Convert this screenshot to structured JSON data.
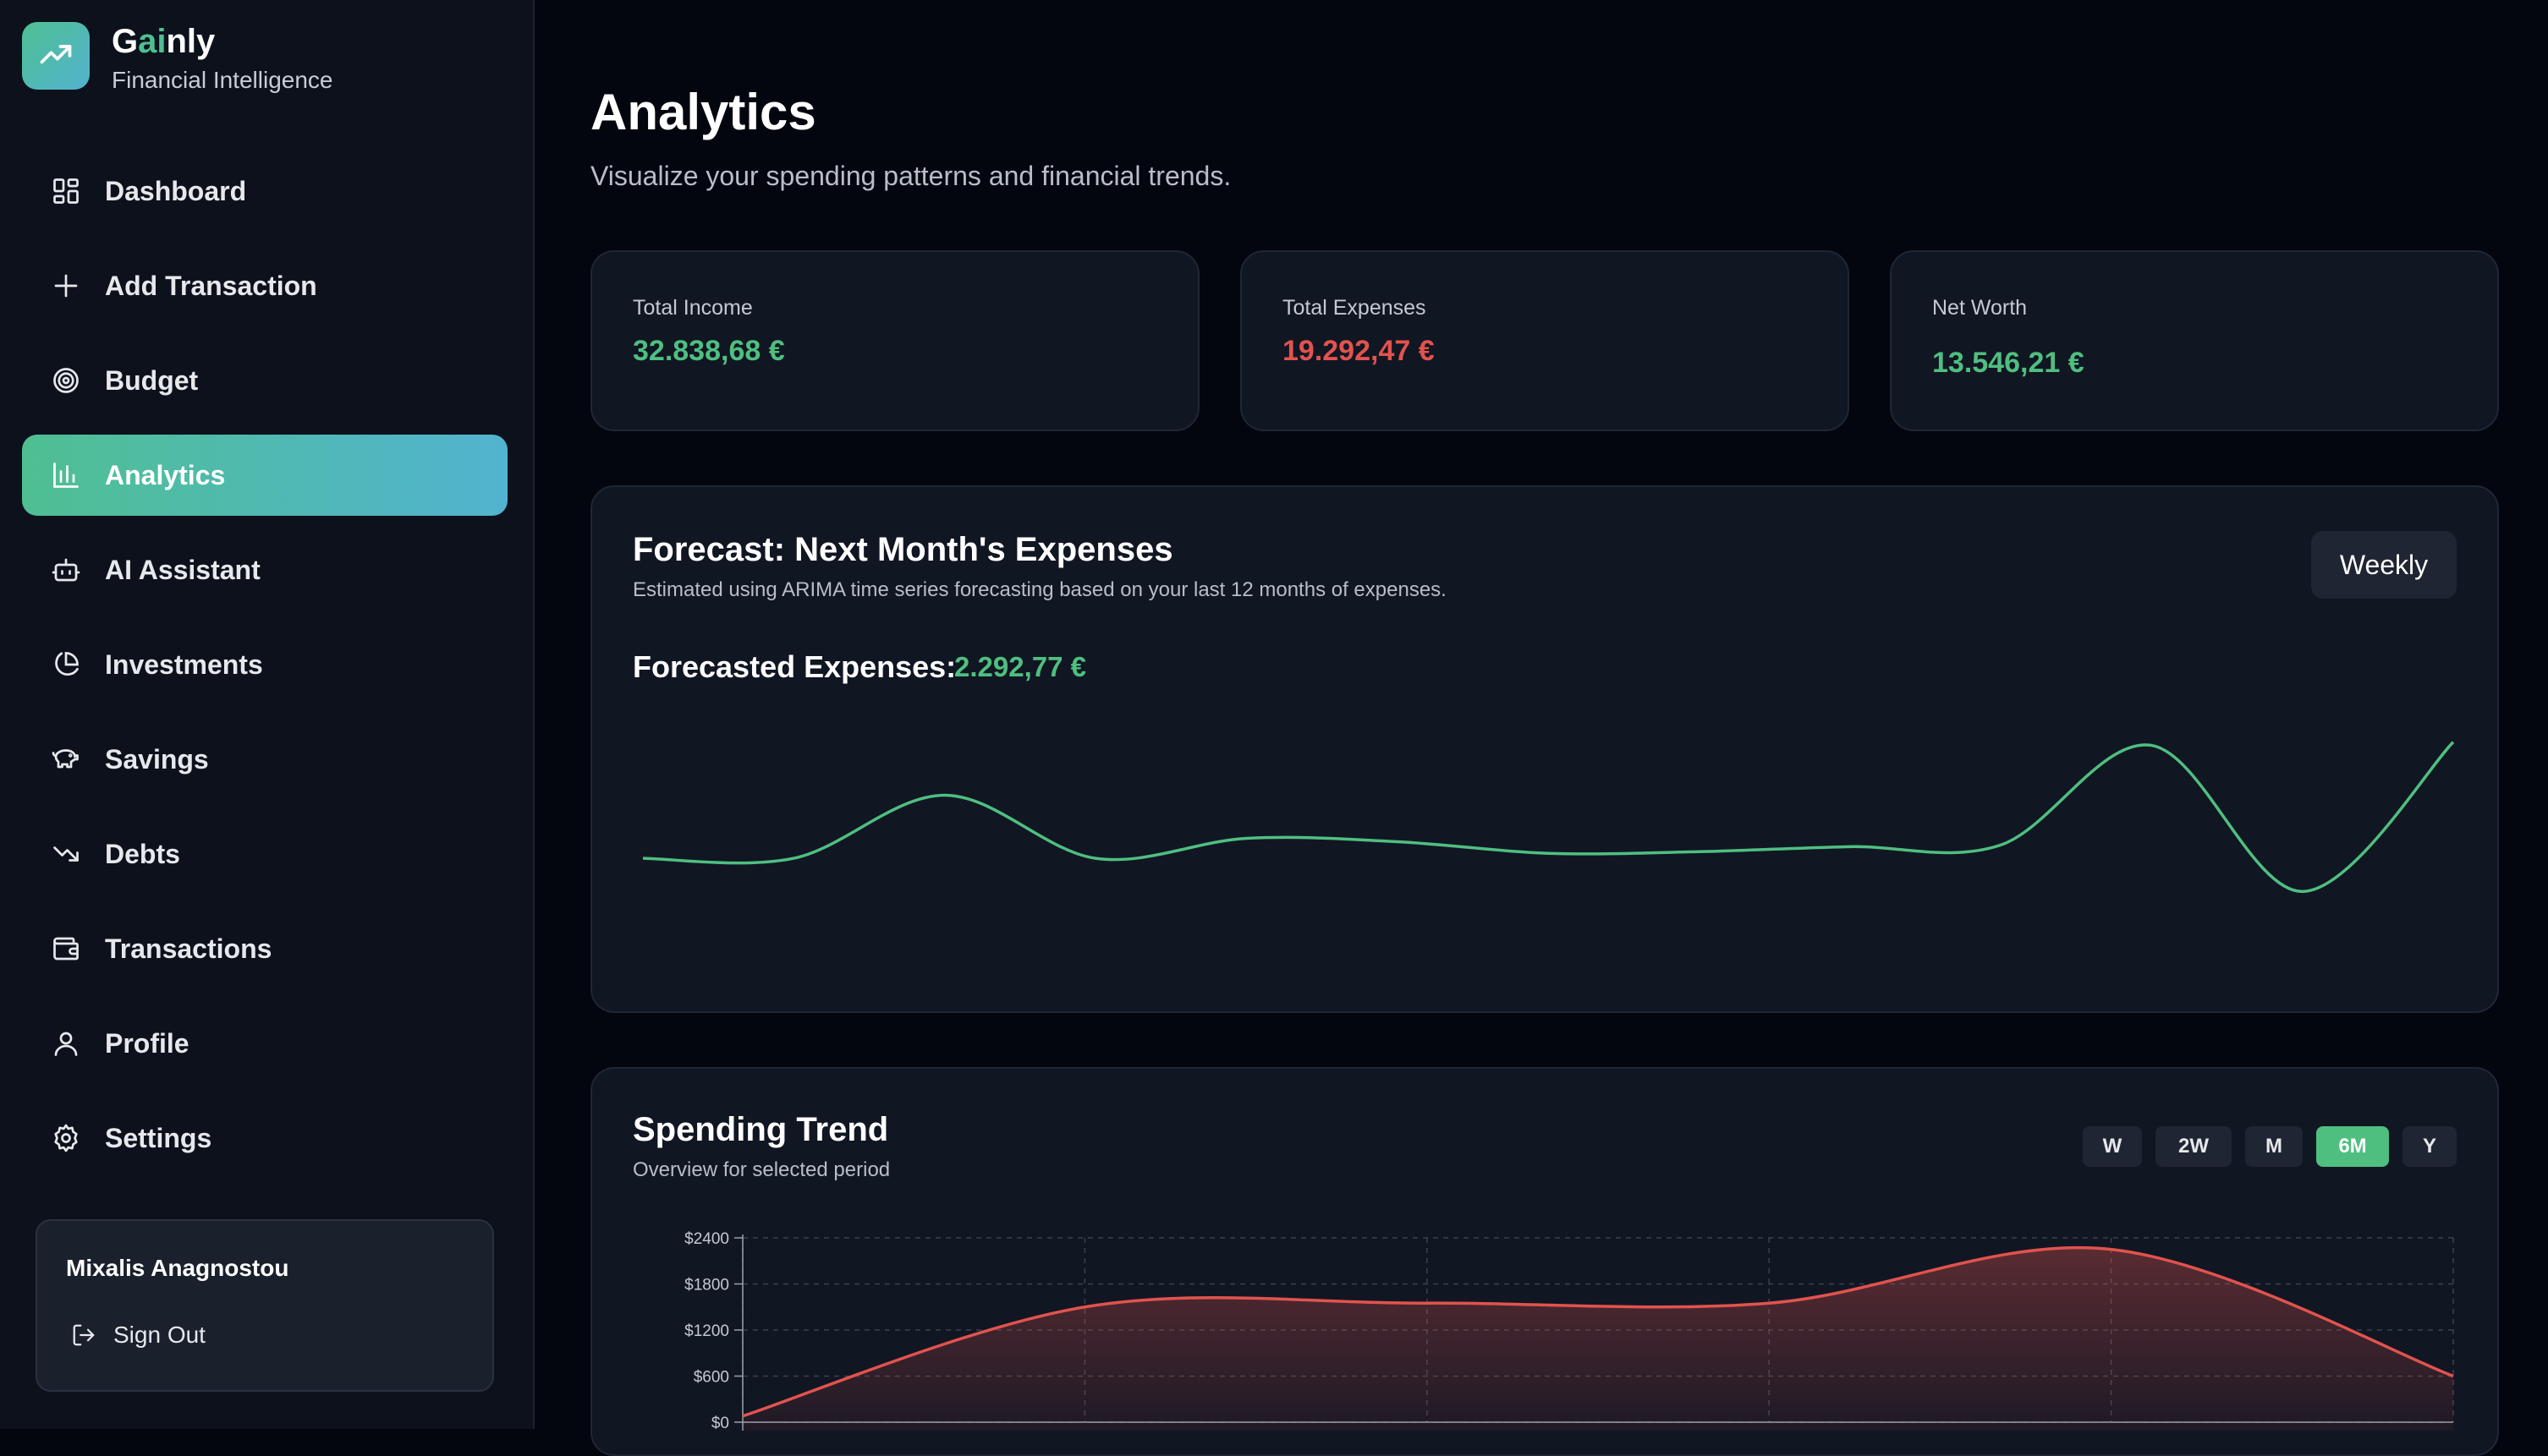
{
  "brand": {
    "name_prefix": "G",
    "name_accent": "ai",
    "name_suffix": "nly",
    "subtitle": "Financial Intelligence"
  },
  "nav": [
    {
      "label": "Dashboard",
      "icon": "dashboard-grid-icon",
      "active": false
    },
    {
      "label": "Add Transaction",
      "icon": "plus-icon",
      "active": false
    },
    {
      "label": "Budget",
      "icon": "target-icon",
      "active": false
    },
    {
      "label": "Analytics",
      "icon": "bar-chart-icon",
      "active": true
    },
    {
      "label": "AI Assistant",
      "icon": "robot-icon",
      "active": false
    },
    {
      "label": "Investments",
      "icon": "pie-chart-icon",
      "active": false
    },
    {
      "label": "Savings",
      "icon": "piggy-bank-icon",
      "active": false
    },
    {
      "label": "Debts",
      "icon": "trending-down-icon",
      "active": false
    },
    {
      "label": "Transactions",
      "icon": "wallet-icon",
      "active": false
    },
    {
      "label": "Profile",
      "icon": "user-icon",
      "active": false
    },
    {
      "label": "Settings",
      "icon": "gear-icon",
      "active": false
    }
  ],
  "user": {
    "name": "Mixalis Anagnostou",
    "signout_label": "Sign Out"
  },
  "page": {
    "title": "Analytics",
    "subtitle": "Visualize your spending patterns and financial trends."
  },
  "stats": {
    "income": {
      "label": "Total Income",
      "value": "32.838,68 €"
    },
    "expenses": {
      "label": "Total Expenses",
      "value": "19.292,47 €"
    },
    "net_worth": {
      "label": "Net Worth",
      "value": "13.546,21 €"
    }
  },
  "forecast": {
    "title": "Forecast: Next Month's Expenses",
    "subtitle": "Estimated using ARIMA time series forecasting based on your last 12 months of expenses.",
    "period_button": "Weekly",
    "result_label": "Forecasted Expenses:",
    "result_value": "2.292,77 €"
  },
  "spending": {
    "title": "Spending Trend",
    "subtitle": "Overview for selected period",
    "ranges": [
      "W",
      "2W",
      "M",
      "6M",
      "Y"
    ],
    "active_range": "6M"
  },
  "colors": {
    "accent_green": "#4fbf7f",
    "accent_red": "#e2534d",
    "accent_teal": "#52b3d0"
  },
  "chart_data": [
    {
      "type": "line",
      "title": "",
      "x": [
        1,
        2,
        3,
        4,
        5,
        6,
        7,
        8,
        9,
        10,
        11,
        12,
        13
      ],
      "series": [
        {
          "values": [
            1950,
            1950,
            2140,
            1950,
            2010,
            2000,
            1965,
            1970,
            1985,
            1990,
            2290,
            1850,
            2300
          ]
        }
      ],
      "grid": false,
      "ylim": [
        1800,
        2350
      ]
    },
    {
      "type": "area",
      "title": "",
      "x": [
        1,
        2,
        3,
        4,
        5,
        6
      ],
      "series": [
        {
          "values": [
            80,
            1500,
            1550,
            1550,
            2250,
            600
          ]
        }
      ],
      "yticks": [
        "$0",
        "$600",
        "$1200",
        "$1800",
        "$2400"
      ],
      "ylim": [
        0,
        2400
      ],
      "grid": true
    }
  ]
}
